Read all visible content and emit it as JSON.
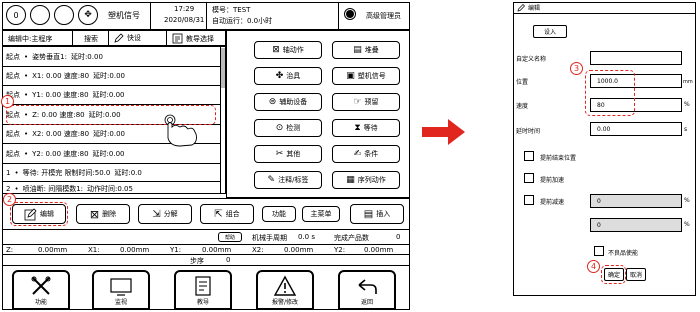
{
  "header": {
    "counter": "0",
    "signal_label": "塑机信号",
    "time": "17:29",
    "date": "2020/08/31",
    "mold_label": "模号：TEST",
    "auto_run": "自动运行：0.0小时",
    "user_level": "高级管理员"
  },
  "toolbar": {
    "edit_mode": "编辑中:主程序",
    "search": "搜索",
    "quick_edit": "快设",
    "teach_select": "教导选择"
  },
  "program_rows": [
    {
      "c1": "起点",
      "c2": "•",
      "c3": "姿势垂直1:",
      "c4": "延时:0.00"
    },
    {
      "c1": "起点",
      "c2": "•",
      "c3": "X1: 0.00 速度:80",
      "c4": "延时:0.00"
    },
    {
      "c1": "起点",
      "c2": "•",
      "c3": "Y1: 0.00 速度:80",
      "c4": "延时:0.00"
    },
    {
      "c1": "起点",
      "c2": "•",
      "c3": "Z: 0.00 速度:80",
      "c4": "延时:0.00"
    },
    {
      "c1": "起点",
      "c2": "•",
      "c3": "X2: 0.00 速度:80",
      "c4": "延时:0.00"
    },
    {
      "c1": "起点",
      "c2": "•",
      "c3": "Y2: 0.00 速度:80",
      "c4": "延时:0.00"
    },
    {
      "c1": "1",
      "c2": "•",
      "c3": "等待: 开模完 限制时间:50.0",
      "c4": "延时:0.0"
    },
    {
      "c1": "2",
      "c2": "•",
      "c3": "喷油断: 间隔模数1:",
      "c4": "动作时间:0.05"
    }
  ],
  "actions": {
    "axis_action": "轴动作",
    "stack": "堆叠",
    "fixture": "治具",
    "machine_signal": "塑机信号",
    "aux_device": "辅助设备",
    "reserve": "预留",
    "detect": "检测",
    "wait": "等待",
    "other": "其他",
    "condition": "条件",
    "annotation": "注释/标签",
    "sequence": "序列动作"
  },
  "bottom_bar": {
    "edit": "编辑",
    "delete": "删除",
    "split": "分解",
    "combine": "组合",
    "function": "功能",
    "main_menu": "主菜单",
    "insert": "插入"
  },
  "status": {
    "help": "帮助",
    "cycle": "机械手周期",
    "cycle_value": "0.0 s",
    "product_label": "完成产品数",
    "product_value": "0",
    "z_label": "Z:",
    "z_value": "0.00mm",
    "x1_label": "X1:",
    "x1_value": "0.00mm",
    "y1_label": "Y1:",
    "y1_value": "0.00mm",
    "x2_label": "X2:",
    "x2_value": "0.00mm",
    "y2_label": "Y2:",
    "y2_value": "0.00mm",
    "step_label": "步序",
    "step_value": "0"
  },
  "nav": {
    "function": "功能",
    "monitor": "监视",
    "teach": "教导",
    "alarm": "报警/修改",
    "return": "返回"
  },
  "callouts": {
    "c1": "1",
    "c2": "2",
    "c3": "3",
    "c4": "4"
  },
  "dialog": {
    "title": "编辑",
    "set_in": "设入",
    "custom_name_label": "自定义名称",
    "position_label": "位置",
    "position_value": "1000.0",
    "position_unit": "mm",
    "speed_label": "速度",
    "speed_value": "80",
    "speed_unit": "%",
    "delay_label": "延时时间",
    "delay_value": "0.00",
    "delay_unit": "s",
    "early_end": "提前结束位置",
    "early_accel": "提前加速",
    "early_decel": "提前减速",
    "decel_value": "0",
    "decel_unit": "%",
    "val2": "0",
    "val2_unit": "%",
    "defect": "不良品使能",
    "confirm": "确定",
    "cancel": "取消"
  },
  "colors": {
    "accent": "#e0261f"
  }
}
